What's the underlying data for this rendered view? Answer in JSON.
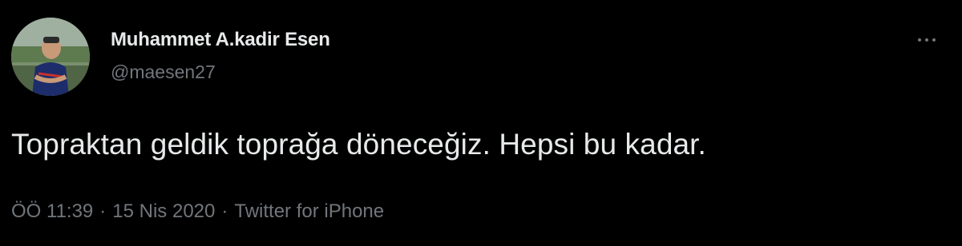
{
  "tweet": {
    "author": {
      "name": "Muhammet A.kadir Esen",
      "handle": "@maesen27",
      "avatar_icon": "avatar-photo"
    },
    "text": "Topraktan geldik toprağa döneceğiz. Hepsi bu kadar.",
    "time": "ÖÖ 11:39",
    "date": "15 Nis 2020",
    "source": "Twitter for iPhone",
    "separator": "·",
    "more_icon": "more-dots-icon"
  },
  "colors": {
    "background": "#000000",
    "text_primary": "#e7e9ea",
    "text_secondary": "#71767b"
  }
}
